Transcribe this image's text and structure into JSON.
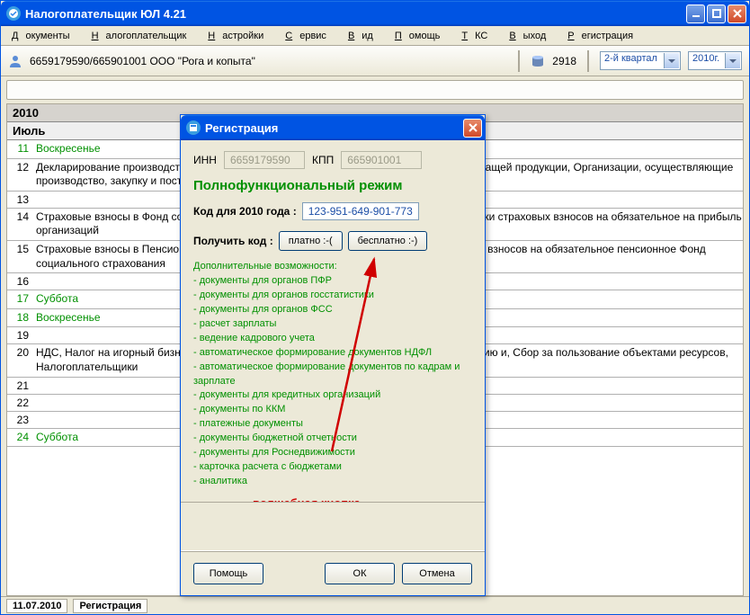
{
  "window": {
    "title": "Налогоплательщик ЮЛ 4.21"
  },
  "menu": {
    "documents": "Документы",
    "taxpayer": "Налогоплательщик",
    "settings": "Настройки",
    "service": "Сервис",
    "view": "Вид",
    "help": "Помощь",
    "tks": "ТКС",
    "exit": "Выход",
    "registration": "Регистрация"
  },
  "toolbar": {
    "org": "6659179590/665901001 ООО \"Рога и копыта\"",
    "number": "2918",
    "quarter": "2-й квартал",
    "year": "2010г."
  },
  "calendar": {
    "year": "2010",
    "month": "Июль",
    "rows": [
      {
        "day": "11",
        "text": "Воскресенье",
        "green": true
      },
      {
        "day": "12",
        "text": "Декларирование производства и оборота этилового спирта, алкогольной и спиртосодержащей продукции, Организации, осуществляющие производство, закупку и поставку",
        "tall": true
      },
      {
        "day": "13",
        "text": ""
      },
      {
        "day": "14",
        "text": "Страховые взносы в Фонд социального страхования Российской Федерации, Плательщики страховых взносов на обязательное на прибыль организаций",
        "tall": true
      },
      {
        "day": "15",
        "text": "Страховые взносы в Пенсионный фонд Российской Федерации, Плательщики страховых взносов на обязательное пенсионное Фонд социального страхования",
        "tall": true
      },
      {
        "day": "16",
        "text": ""
      },
      {
        "day": "17",
        "text": "Суббота",
        "green": true
      },
      {
        "day": "18",
        "text": "Воскресенье",
        "green": true
      },
      {
        "day": "19",
        "text": ""
      },
      {
        "day": "20",
        "text": "НДС, Налог на игорный бизнес, Налогоплательщики, представляющие единую декларацию и, Сбор за пользование объектами ресурсов, Налогоплательщики",
        "tall": true
      },
      {
        "day": "21",
        "text": ""
      },
      {
        "day": "22",
        "text": ""
      },
      {
        "day": "23",
        "text": ""
      },
      {
        "day": "24",
        "text": "Суббота",
        "green": true
      }
    ]
  },
  "statusbar": {
    "date": "11.07.2010",
    "label": "Регистрация"
  },
  "dialog": {
    "title": "Регистрация",
    "inn_label": "ИНН",
    "inn_value": "6659179590",
    "kpp_label": "КПП",
    "kpp_value": "665901001",
    "mode": "Полнофункциональный режим",
    "code_label": "Код для 2010 года :",
    "code_value": "123-951-649-901-773",
    "get_label": "Получить код :",
    "btn_paid": "платно  :-(",
    "btn_free": "бесплатно  :-)",
    "features_header": "Дополнительные возможности:",
    "features": [
      "- документы для органов ПФР",
      "- документы для органов госстатистики",
      "- документы для органов ФСС",
      "- расчет зарплаты",
      "- ведение кадрового учета",
      "- автоматическое формирование документов НДФЛ",
      "- автоматическое формирование документов по кадрам и зарплате",
      "- документы для кредитных организаций",
      "- документы по ККМ",
      "- платежные документы",
      "- документы бюджетной отчетности",
      "- документы для Роснедвижимости",
      "- карточка расчета с бюджетами",
      "- аналитика"
    ],
    "magic": "волшебная кнопка",
    "btn_help": "Помощь",
    "btn_ok": "ОК",
    "btn_cancel": "Отмена"
  }
}
